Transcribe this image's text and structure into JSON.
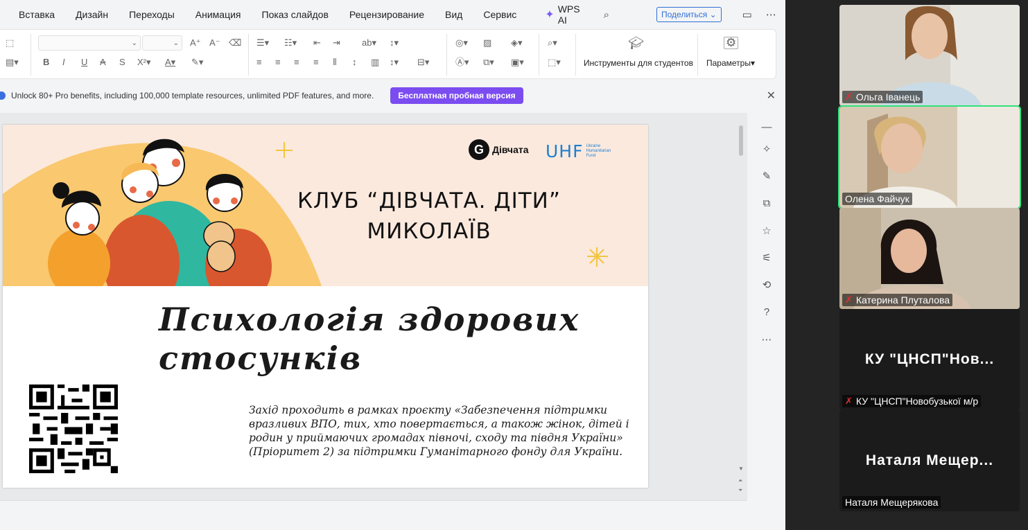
{
  "menu": {
    "items": [
      "Вставка",
      "Дизайн",
      "Переходы",
      "Анимация",
      "Показ слайдов",
      "Рецензирование",
      "Вид",
      "Сервис"
    ],
    "wps_ai": "WPS AI",
    "share": "Поделиться"
  },
  "ribbon": {
    "students_tools": "Инструменты для студентов",
    "parameters": "Параметры"
  },
  "promo": {
    "text": "Unlock 80+ Pro benefits, including 100,000 template resources, unlimited PDF features, and more.",
    "trial_button": "Бесплатная пробная версия"
  },
  "slide": {
    "club_title_line1": "КЛУБ “ДІВЧАТА. ДІТИ”",
    "club_title_line2": "МИКОЛАЇВ",
    "logo_gi_text": "Дівчата",
    "logo_uhf": "UHF",
    "logo_uhf_sub": [
      "Ukraine",
      "Humanitarian",
      "Fund"
    ],
    "main_title_line1": "Психологія здорових",
    "main_title_line2": "стосунків",
    "description": "Захід проходить в рамках проєкту «Забезпечення підтримки вразливих ВПО, тих, хто повертається, а також жінок, дітей і родин у приймаючих громадах півночі, сходу та півдня України» (Пріоритет 2) за підтримки Гуманітарного фонду для України."
  },
  "participants": [
    {
      "name": "Ольга Іванець",
      "muted": true
    },
    {
      "name": "Олена Файчук",
      "muted": false,
      "active": true
    },
    {
      "name": "Катерина Плуталова",
      "muted": true
    },
    {
      "name": "КУ \"ЦНСП\"Новобузької м/р",
      "display": "КУ  \"ЦНСП\"Нов...",
      "muted": true
    },
    {
      "name": "Наталя Мещерякова",
      "display": "Наталя  Мещер...",
      "muted": false
    }
  ],
  "colors": {
    "accent_purple": "#7b4cf0",
    "active_speaker": "#2ee37a",
    "mic_muted": "#e03131",
    "uhf_blue": "#1f7fcf",
    "banner_orange": "#f9c86f"
  }
}
